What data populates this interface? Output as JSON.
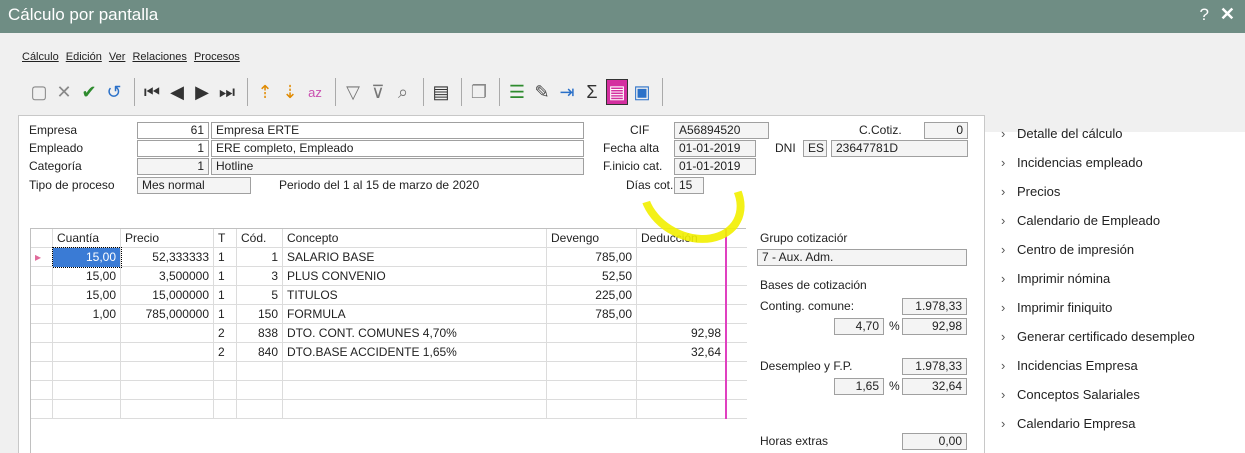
{
  "window": {
    "title": "Cálculo por pantalla",
    "help": "?",
    "close": "✕"
  },
  "menu": [
    "Cálculo",
    "Edición",
    "Ver",
    "Relaciones",
    "Procesos"
  ],
  "toolbar_icons": [
    "new-icon",
    "delete-icon",
    "check-icon",
    "undo-icon",
    "first-icon",
    "prev-icon",
    "next-icon",
    "last-icon",
    "sort-up-icon",
    "sort-down-icon",
    "sort-az-icon",
    "filter-icon",
    "clear-filter-icon",
    "search-icon",
    "grid-icon",
    "copy-icon",
    "list-icon",
    "edit-icon",
    "export-icon",
    "sum-icon",
    "view-icon",
    "preview-icon"
  ],
  "form": {
    "empresa_label": "Empresa",
    "empresa_num": "61",
    "empresa_name": "Empresa ERTE",
    "empleado_label": "Empleado",
    "empleado_num": "1",
    "empleado_name": "ERE completo, Empleado",
    "categoria_label": "Categoría",
    "categoria_num": "1",
    "categoria_name": "Hotline",
    "tipo_label": "Tipo de proceso",
    "tipo_value": "Mes normal",
    "periodo": "Periodo del 1 al 15 de marzo de 2020",
    "cif_label": "CIF",
    "cif_value": "A56894520",
    "ccotiz_label": "C.Cotiz.",
    "ccotiz_value": "0",
    "fecha_alta_label": "Fecha alta",
    "fecha_alta_value": "01-01-2019",
    "dni_label": "DNI",
    "dni_country": "ES",
    "dni_value": "23647781D",
    "finicio_label": "F.inicio cat.",
    "finicio_value": "01-01-2019",
    "dias_label": "Días cot.",
    "dias_value": "15"
  },
  "table": {
    "headers": [
      "Cuantía",
      "Precio",
      "T",
      "Cód.",
      "Concepto",
      "Devengo",
      "Deducción"
    ],
    "rows": [
      [
        "15,00",
        "52,333333",
        "1",
        "1",
        "SALARIO BASE",
        "785,00",
        ""
      ],
      [
        "15,00",
        "3,500000",
        "1",
        "3",
        "PLUS CONVENIO",
        "52,50",
        ""
      ],
      [
        "15,00",
        "15,000000",
        "1",
        "5",
        "TITULOS",
        "225,00",
        ""
      ],
      [
        "1,00",
        "785,000000",
        "1",
        "150",
        "FORMULA",
        "785,00",
        ""
      ],
      [
        "",
        "",
        "2",
        "838",
        "DTO. CONT. COMUNES 4,70%",
        "",
        "92,98"
      ],
      [
        "",
        "",
        "2",
        "840",
        "DTO.BASE ACCIDENTE 1,65%",
        "",
        "32,64"
      ],
      [
        "",
        "",
        "",
        "",
        "",
        "",
        ""
      ],
      [
        "",
        "",
        "",
        "",
        "",
        "",
        ""
      ],
      [
        "",
        "",
        "",
        "",
        "",
        "",
        ""
      ]
    ]
  },
  "cotizacion": {
    "grupo_label": "Grupo cotizaciór",
    "grupo_value": "7 - Aux. Adm.",
    "bases_label": "Bases de cotización",
    "conting_label": "Conting. comune:",
    "conting_value": "1.978,33",
    "conting_pct": "4,70",
    "pct_sign": "%",
    "conting_amount": "92,98",
    "desempleo_label": "Desempleo y F.P.",
    "desempleo_value": "1.978,33",
    "desempleo_pct": "1,65",
    "desempleo_amount": "32,64",
    "horas_label": "Horas extras",
    "horas_value": "0,00"
  },
  "sidebar": [
    "Detalle del cálculo",
    "Incidencias empleado",
    "Precios",
    "Calendario de Empleado",
    "Centro de impresión",
    "Imprimir nómina",
    "Imprimir finiquito",
    "Generar certificado desempleo",
    "Incidencias Empresa",
    "Conceptos Salariales",
    "Calendario Empresa"
  ],
  "colors": {
    "titlebar": "#6f8d84",
    "highlight": "#f2f000",
    "selected": "#3a7bd5"
  }
}
